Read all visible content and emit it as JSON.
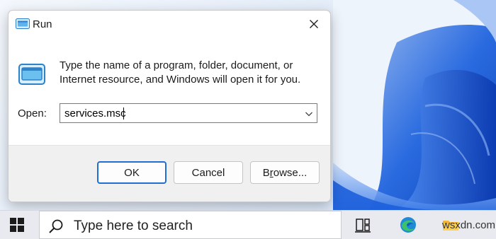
{
  "run_dialog": {
    "title": "Run",
    "description": "Type the name of a program, folder, document, or Internet resource, and Windows will open it for you.",
    "open_label": "Open:",
    "open_value": "services.msc",
    "buttons": {
      "ok": "OK",
      "cancel": "Cancel",
      "browse_prefix": "B",
      "browse_underlined": "r",
      "browse_suffix": "owse..."
    }
  },
  "taskbar": {
    "search_placeholder": "Type here to search",
    "icons": [
      "windows-start-icon",
      "task-view-icon",
      "edge-icon",
      "file-explorer-icon"
    ]
  },
  "watermark": "wsxdn.com",
  "colors": {
    "accent": "#1f6fd1",
    "wallpaper_blue": "#1356d9",
    "taskbar": "#e8eaef"
  }
}
